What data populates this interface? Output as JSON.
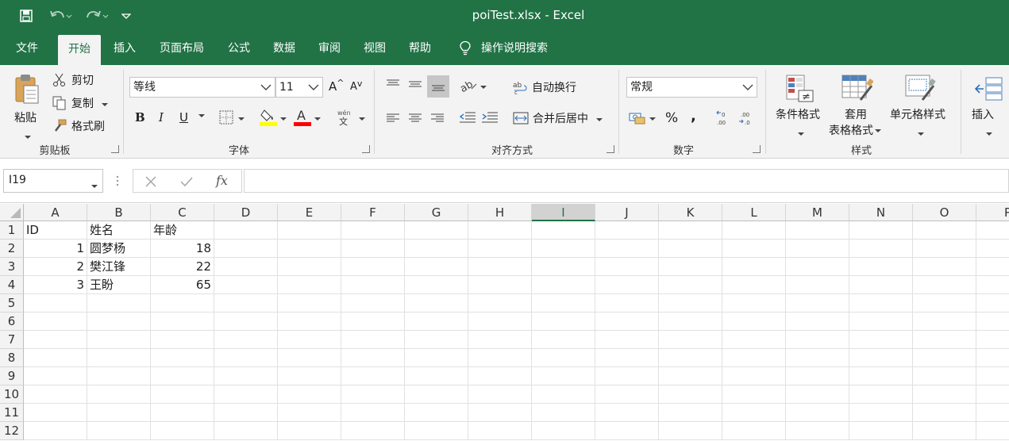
{
  "window": {
    "title": "poiTest.xlsx  -  Excel"
  },
  "tabs": [
    "文件",
    "开始",
    "插入",
    "页面布局",
    "公式",
    "数据",
    "审阅",
    "视图",
    "帮助"
  ],
  "tell_me": "操作说明搜索",
  "ribbon": {
    "clipboard": {
      "paste": "粘贴",
      "cut": "剪切",
      "copy": "复制",
      "format_painter": "格式刷",
      "label": "剪贴板"
    },
    "font": {
      "font_name": "等线",
      "font_size": "11",
      "label": "字体"
    },
    "alignment": {
      "wrap_text": "自动换行",
      "merge_center": "合并后居中",
      "label": "对齐方式"
    },
    "number": {
      "format": "常规",
      "percent": "%",
      "comma": ",",
      "label": "数字"
    },
    "styles": {
      "conditional": "条件格式",
      "table_l1": "套用",
      "table_l2": "表格格式",
      "cell_styles": "单元格样式",
      "label": "样式"
    },
    "cells": {
      "insert": "插入"
    }
  },
  "formula_bar": {
    "name_box": "I19",
    "fx": "fx",
    "value": ""
  },
  "sheet": {
    "columns": [
      "A",
      "B",
      "C",
      "D",
      "E",
      "F",
      "G",
      "H",
      "I",
      "J",
      "K",
      "L",
      "M",
      "N",
      "O",
      "P"
    ],
    "selected_column": "I",
    "rows": [
      "1",
      "2",
      "3",
      "4",
      "5",
      "6",
      "7",
      "8",
      "9",
      "10",
      "11",
      "12"
    ],
    "cells": {
      "A1": "ID",
      "B1": "姓名",
      "C1": "年龄",
      "A2": "1",
      "B2": "圆梦杨",
      "C2": "18",
      "A3": "2",
      "B3": "樊江锋",
      "C3": "22",
      "A4": "3",
      "B4": "王盼",
      "C4": "65"
    }
  },
  "colors": {
    "brand": "#217346",
    "font_highlight": "#ffff00",
    "font_color": "#ff0000"
  }
}
